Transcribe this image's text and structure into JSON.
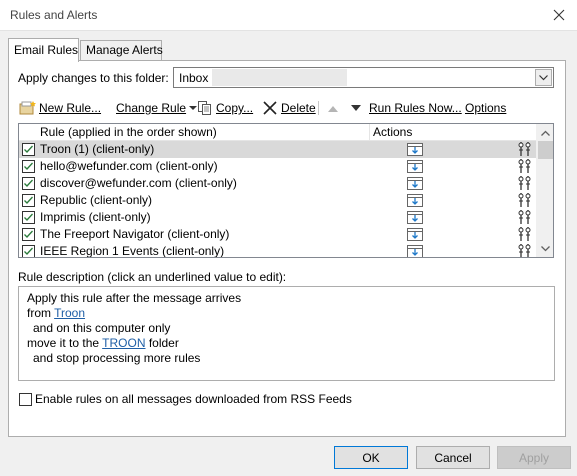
{
  "window": {
    "title": "Rules and Alerts",
    "close_icon": "close-icon"
  },
  "tabs": [
    {
      "label": "Email Rules",
      "active": true
    },
    {
      "label": "Manage Alerts",
      "active": false
    }
  ],
  "folder": {
    "label": "Apply changes to this folder:",
    "value": "Inbox"
  },
  "toolbar": {
    "new_rule": "New Rule...",
    "change_rule": "Change Rule",
    "copy": "Copy...",
    "delete": "Delete",
    "run_rules_now": "Run Rules Now...",
    "options": "Options"
  },
  "rules_list": {
    "col_rule": "Rule (applied in the order shown)",
    "col_actions": "Actions",
    "rows": [
      {
        "name": "Troon (1)  (client-only)",
        "checked": true,
        "selected": true
      },
      {
        "name": "hello@wefunder.com  (client-only)",
        "checked": true,
        "selected": false
      },
      {
        "name": "discover@wefunder.com  (client-only)",
        "checked": true,
        "selected": false
      },
      {
        "name": "Republic  (client-only)",
        "checked": true,
        "selected": false
      },
      {
        "name": "Imprimis  (client-only)",
        "checked": true,
        "selected": false
      },
      {
        "name": "The Freeport Navigator  (client-only)",
        "checked": true,
        "selected": false
      },
      {
        "name": "IEEE Region 1 Events  (client-only)",
        "checked": true,
        "selected": false
      }
    ]
  },
  "description": {
    "label": "Rule description (click an underlined value to edit):",
    "line1": "Apply this rule after the message arrives",
    "line2_prefix": "from ",
    "line2_link": "Troon",
    "line3": "and on this computer only",
    "line4_prefix": "move it to the ",
    "line4_link": "TROON",
    "line4_suffix": " folder",
    "line5": "and stop processing more rules"
  },
  "rss": {
    "label": "Enable rules on all messages downloaded from RSS Feeds",
    "checked": false
  },
  "buttons": {
    "ok": "OK",
    "cancel": "Cancel",
    "apply": "Apply"
  },
  "colors": {
    "link": "#1f5fa6",
    "selected_row": "#d9d9d9",
    "check": "#2a7a3a"
  }
}
